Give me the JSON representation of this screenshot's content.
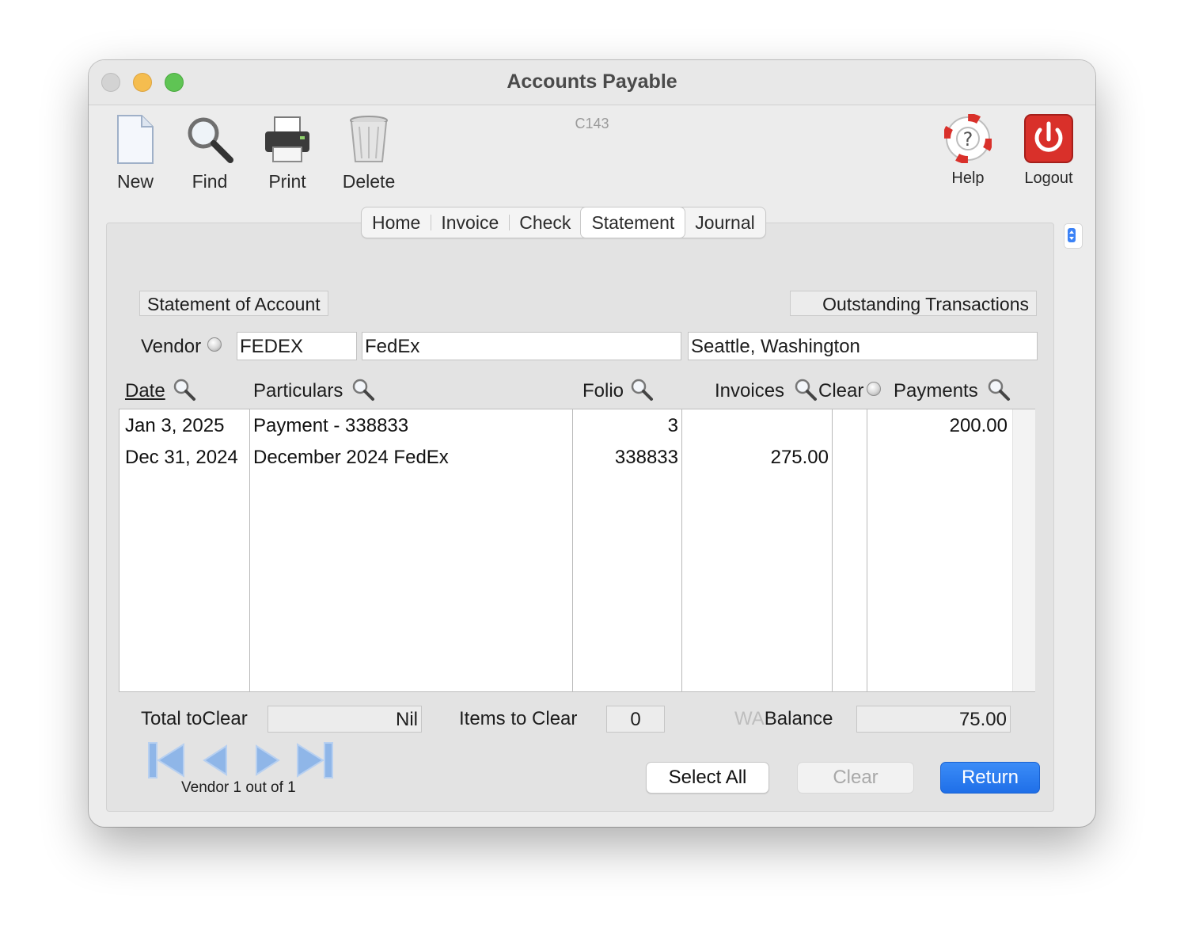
{
  "window": {
    "title": "Accounts Payable",
    "code": "C143"
  },
  "toolbar": {
    "new_label": "New",
    "find_label": "Find",
    "print_label": "Print",
    "delete_label": "Delete",
    "help_label": "Help",
    "logout_label": "Logout"
  },
  "tabs": [
    "Home",
    "Invoice",
    "Check",
    "Statement",
    "Journal"
  ],
  "active_tab": "Statement",
  "statement": {
    "left_label": "Statement of Account",
    "right_label": "Outstanding Transactions",
    "vendor_label": "Vendor",
    "vendor_code": "FEDEX",
    "vendor_name": "FedEx",
    "vendor_location": "Seattle, Washington"
  },
  "columns": {
    "date": "Date",
    "particulars": "Particulars",
    "folio": "Folio",
    "invoices": "Invoices",
    "clear": "Clear",
    "payments": "Payments"
  },
  "rows": [
    {
      "date": "Jan 3, 2025",
      "particulars": "Payment - 338833",
      "folio": "3",
      "invoices": "",
      "payments": "200.00"
    },
    {
      "date": "Dec 31, 2024",
      "particulars": "December 2024 FedEx",
      "folio": "338833",
      "invoices": "275.00",
      "payments": ""
    }
  ],
  "summary": {
    "total_label_a": "Total to",
    "total_label_b": "Clear",
    "total_value": "Nil",
    "items_label_a": "Items to",
    "items_label_b": "Clear",
    "items_value": "0",
    "balance_prefix": "WA",
    "balance_label": "Balance",
    "balance_value": "75.00"
  },
  "nav": {
    "caption": "Vendor 1 out of 1"
  },
  "buttons": {
    "select_all": "Select All",
    "clear": "Clear",
    "return": "Return"
  },
  "colors": {
    "accent": "#1f6fe8",
    "logout_red": "#d9302a",
    "nav_blue": "#8fb6e8"
  }
}
